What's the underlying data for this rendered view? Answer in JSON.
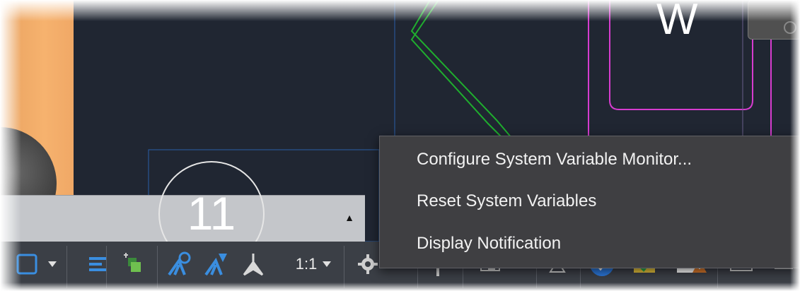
{
  "canvas": {
    "circle_number": "11",
    "corner_letter": "W",
    "colors": {
      "background": "#202632",
      "green_lines": "#1fae2e",
      "magenta_lines": "#d63ccf",
      "blue_lines": "#2a5fa8",
      "orange_panel": "#f4b06c"
    }
  },
  "command_line": {
    "expand_icon": "triangle-up-icon"
  },
  "context_menu": {
    "items": [
      {
        "label": "Configure System Variable Monitor..."
      },
      {
        "label": "Reset System Variables"
      },
      {
        "label": "Display Notification"
      }
    ]
  },
  "statusbar": {
    "annotation_scale": "1:1",
    "icons": [
      "selection-box-icon",
      "dropdown-arrow-icon",
      "lineweight-icon",
      "transparency-icon",
      "annotation-visibility-icon",
      "auto-scale-icon",
      "annotation-scale-icon",
      "workspace-gear-icon",
      "annotation-monitor-icon",
      "units-icon",
      "quick-properties-icon",
      "lock-ui-icon",
      "isolate-objects-icon",
      "hardware-acceleration-icon",
      "clean-screen-icon"
    ]
  }
}
